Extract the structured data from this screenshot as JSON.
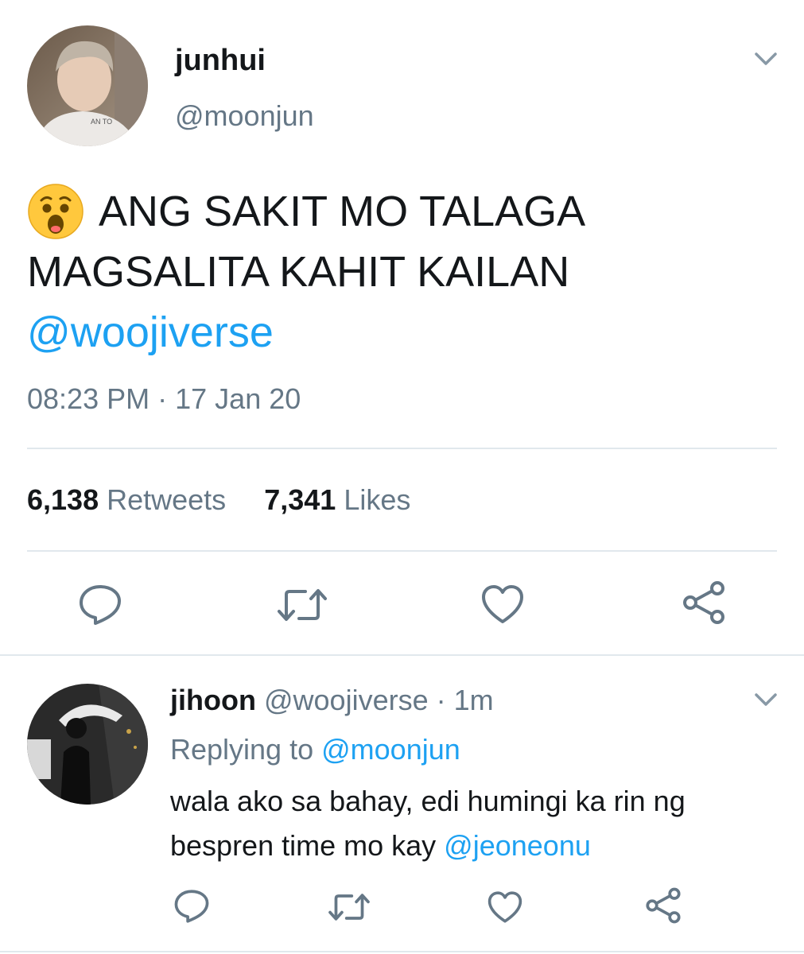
{
  "main_tweet": {
    "display_name": "junhui",
    "handle": "@moonjun",
    "emoji": "😮",
    "text_line1": "ANG SAKIT MO TALAGA",
    "text_line2": "MAGSALITA KAHIT KAILAN",
    "mention": "@woojiverse",
    "time": "08:23 PM",
    "separator": "·",
    "date": "17 Jan 20",
    "retweets_count": "6,138",
    "retweets_label": "Retweets",
    "likes_count": "7,341",
    "likes_label": "Likes",
    "actions": [
      "reply-icon",
      "retweet-icon",
      "like-icon",
      "share-icon"
    ]
  },
  "reply": {
    "display_name": "jihoon",
    "handle": "@woojiverse",
    "separator": "·",
    "age": "1m",
    "replying_to_label": "Replying to",
    "replying_to_handle": "@moonjun",
    "text_line1": "wala ako sa bahay, edi humingi ka rin ng",
    "text_line2": "bespren time mo kay",
    "mention": "@jeoneonu",
    "actions": [
      "reply-icon",
      "retweet-icon",
      "like-icon",
      "share-icon"
    ]
  },
  "colors": {
    "text": "#14171a",
    "muted": "#657786",
    "link": "#1da1f2",
    "divider": "#e1e8ed"
  }
}
